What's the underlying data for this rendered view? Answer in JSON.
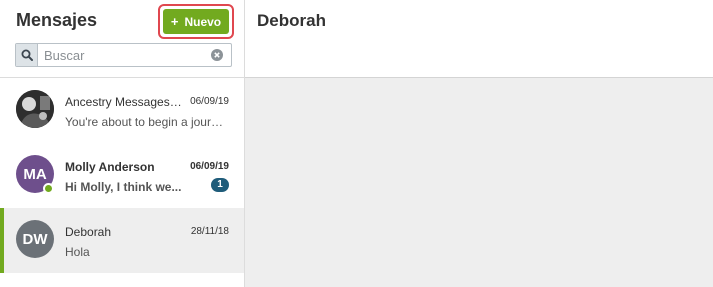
{
  "sidebar": {
    "title": "Mensajes",
    "new_button": {
      "label": "Nuevo",
      "icon": "plus-icon",
      "color": "#72aa1f",
      "highlight_color": "#e0474f"
    },
    "search": {
      "placeholder": "Buscar",
      "icon": "search-icon",
      "clear_icon": "clear-icon"
    },
    "conversations": [
      {
        "name": "Ancestry Messages T...",
        "date": "06/09/19",
        "preview": "You're about to begin a journ...",
        "avatar": "photo",
        "unread": false
      },
      {
        "name": "Molly Anderson",
        "date": "06/09/19",
        "preview": "Hi Molly, I think we...",
        "avatar_initials": "MA",
        "avatar_color": "#6e4f8c",
        "online": true,
        "unread": true,
        "unread_count": "1"
      },
      {
        "name": "Deborah",
        "date": "28/11/18",
        "preview": "Hola",
        "avatar_initials": "DW",
        "avatar_color": "#6b7177",
        "selected": true
      }
    ]
  },
  "main": {
    "title": "Deborah"
  }
}
